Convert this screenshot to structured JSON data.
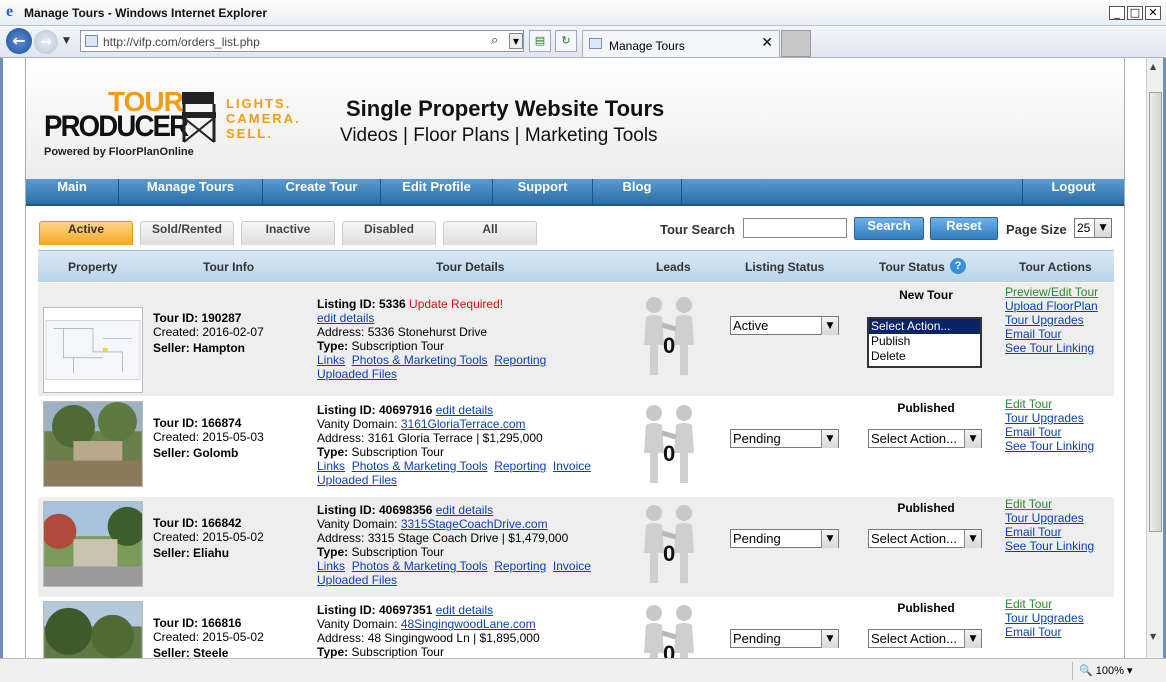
{
  "window": {
    "title": "Manage Tours - Windows Internet Explorer"
  },
  "browser": {
    "url": "http://vifp.com/orders_list.php",
    "tab_title": "Manage Tours",
    "zoom": "100%"
  },
  "site": {
    "logo": {
      "tour": "TOUR",
      "producer": "PRODUCER",
      "tagline": [
        "LIGHTS.",
        "CAMERA.",
        "SELL."
      ],
      "powered": "Powered by FloorPlanOnline"
    },
    "headline": "Single Property Website Tours",
    "subheadline": "Videos | Floor Plans | Marketing Tools",
    "menu": [
      "Main",
      "Manage Tours",
      "Create Tour",
      "Edit Profile",
      "Support",
      "Blog",
      "Logout"
    ],
    "status_tabs": [
      "Active",
      "Sold/Rented",
      "Inactive",
      "Disabled",
      "All"
    ],
    "active_tab": "Active",
    "search": {
      "label": "Tour Search",
      "value": "",
      "search_button": "Search",
      "reset_button": "Reset",
      "page_size_label": "Page Size",
      "page_size": "25"
    },
    "columns": [
      "Property",
      "Tour Info",
      "Tour Details",
      "Leads",
      "Listing Status",
      "Tour Status",
      "Tour Actions"
    ],
    "rows": [
      {
        "tour_id": "Tour ID: 190287",
        "created": "Created: 2016-02-07",
        "seller": "Seller: Hampton",
        "listing_id": "Listing ID: 5336",
        "warning": "Update Required!",
        "edit_details": "edit details",
        "vanity_label": "",
        "vanity": "",
        "address": "Address: 5336 Stonehurst Drive",
        "type_label": "Type:",
        "type": "Subscription Tour",
        "links": [
          "Links",
          "Photos & Marketing Tools",
          "Reporting"
        ],
        "uploaded": "Uploaded Files",
        "leads": "0",
        "listing_status": "Active",
        "tour_status": "New Tour",
        "tour_status_options": [
          "Select Action...",
          "Publish",
          "Delete"
        ],
        "actions": [
          "Preview/Edit Tour",
          "Upload FloorPlan",
          "Tour Upgrades",
          "Email Tour",
          "See Tour Linking"
        ]
      },
      {
        "tour_id": "Tour ID: 166874",
        "created": "Created: 2015-05-03",
        "seller": "Seller: Golomb",
        "listing_id": "Listing ID: 40697916",
        "edit_details": "edit details",
        "vanity_label": "Vanity Domain:",
        "vanity": "3161GloriaTerrace.com",
        "address": "Address: 3161 Gloria Terrace | $1,295,000",
        "type_label": "Type:",
        "type": "Subscription Tour",
        "links": [
          "Links",
          "Photos & Marketing Tools",
          "Reporting",
          "Invoice"
        ],
        "uploaded": "Uploaded Files",
        "leads": "0",
        "listing_status": "Pending",
        "tour_status": "Published",
        "tour_action_select": "Select Action...",
        "actions": [
          "Edit Tour",
          "Tour Upgrades",
          "Email Tour",
          "See Tour Linking"
        ]
      },
      {
        "tour_id": "Tour ID: 166842",
        "created": "Created: 2015-05-02",
        "seller": "Seller: Eliahu",
        "listing_id": "Listing ID: 40698356",
        "edit_details": "edit details",
        "vanity_label": "Vanity Domain:",
        "vanity": "3315StageCoachDrive.com",
        "address": "Address: 3315 Stage Coach Drive | $1,479,000",
        "type_label": "Type:",
        "type": "Subscription Tour",
        "links": [
          "Links",
          "Photos & Marketing Tools",
          "Reporting",
          "Invoice"
        ],
        "uploaded": "Uploaded Files",
        "leads": "0",
        "listing_status": "Pending",
        "tour_status": "Published",
        "tour_action_select": "Select Action...",
        "actions": [
          "Edit Tour",
          "Tour Upgrades",
          "Email Tour",
          "See Tour Linking"
        ]
      },
      {
        "tour_id": "Tour ID: 166816",
        "created": "Created: 2015-05-02",
        "seller": "Seller: Steele",
        "listing_id": "Listing ID: 40697351",
        "edit_details": "edit details",
        "vanity_label": "Vanity Domain:",
        "vanity": "48SingingwoodLane.com",
        "address": "Address: 48 Singingwood Ln | $1,895,000",
        "type_label": "Type:",
        "type": "Subscription Tour",
        "leads": "0",
        "listing_status": "Pending",
        "tour_status": "Published",
        "tour_action_select": "Select Action...",
        "actions": [
          "Edit Tour",
          "Tour Upgrades",
          "Email Tour"
        ]
      }
    ]
  }
}
